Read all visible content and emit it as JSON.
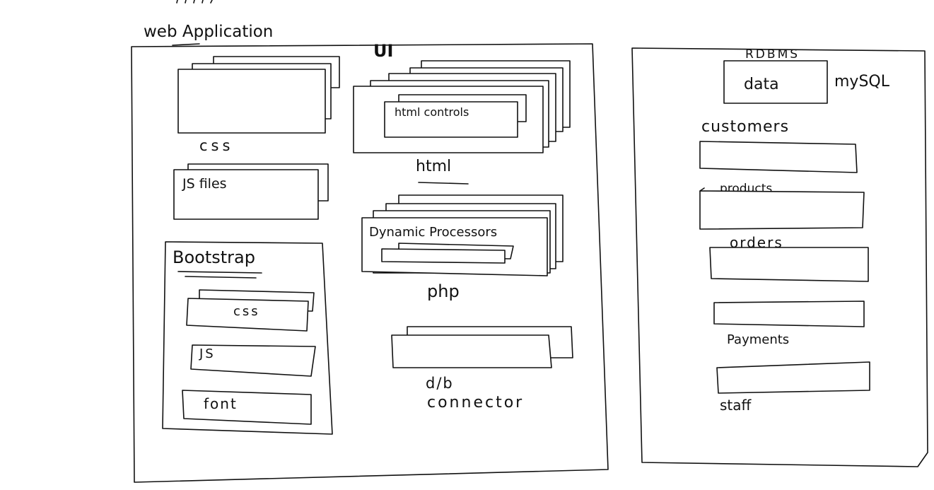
{
  "web_app": {
    "title": "web Application",
    "ui_label": "UI",
    "css_label": "css",
    "js_files_label": "JS files",
    "bootstrap": {
      "title": "Bootstrap",
      "css": "css",
      "js": "JS",
      "font": "font"
    },
    "html_controls_label": "html controls",
    "html_label": "html",
    "dynamic_label": "Dynamic Processors",
    "php_label": "php",
    "db_connector_line1": "d/b",
    "db_connector_line2": "connector"
  },
  "rdbms": {
    "title": "RDBMS",
    "data_label": "data",
    "engine": "mySQL",
    "tables": [
      "customers",
      "products",
      "orders",
      "Payments",
      "staff"
    ]
  },
  "colors": {
    "ink": "#111111",
    "paper": "#ffffff"
  }
}
